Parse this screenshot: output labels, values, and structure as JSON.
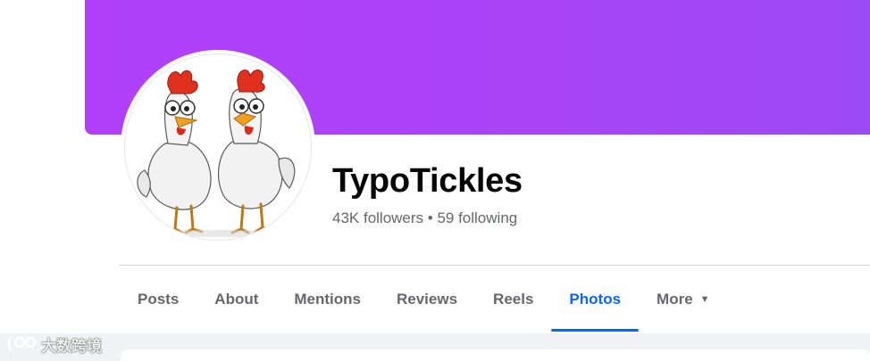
{
  "profile": {
    "name": "TypoTickles",
    "stats": "43K followers • 59 following"
  },
  "colors": {
    "cover_gradient_start": "#b23ffa",
    "cover_gradient_end": "#9c4af3",
    "active_tab": "#0866ff",
    "tab_text": "#65676b"
  },
  "tabs": [
    {
      "label": "Posts",
      "active": false
    },
    {
      "label": "About",
      "active": false
    },
    {
      "label": "Mentions",
      "active": false
    },
    {
      "label": "Reviews",
      "active": false
    },
    {
      "label": "Reels",
      "active": false
    },
    {
      "label": "Photos",
      "active": true
    },
    {
      "label": "More",
      "active": false,
      "icon": "caret-down-icon"
    }
  ],
  "watermark": {
    "text": "大数跨境",
    "icon": "brand-logo-icon"
  }
}
